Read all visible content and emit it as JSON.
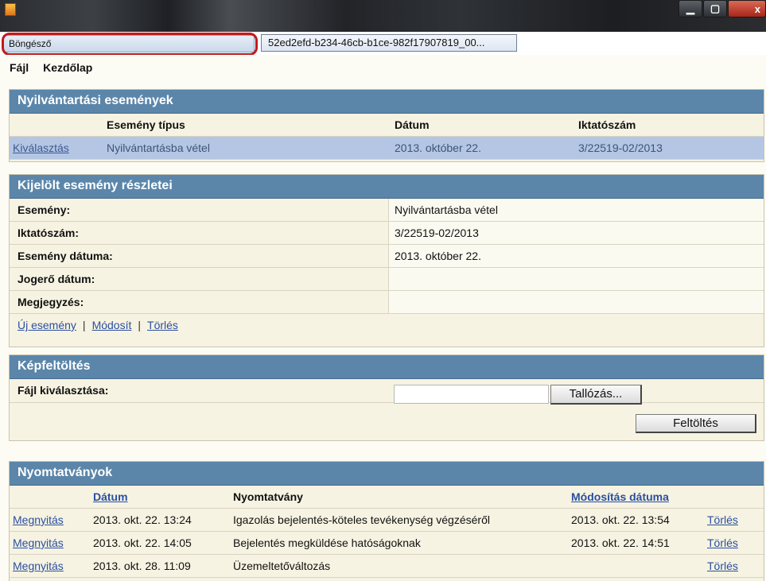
{
  "window": {
    "minimize_glyph": "▁",
    "maximize_glyph": "▢",
    "close_glyph": "x"
  },
  "tabs": {
    "main_label": "Böngésző",
    "second_label": "52ed2efd-b234-46cb-b1ce-982f17907819_00..."
  },
  "menu": {
    "items": [
      "Fájl",
      "Kezdőlap"
    ]
  },
  "events": {
    "title": "Nyilvántartási események",
    "headers": {
      "type": "Esemény típus",
      "date": "Dátum",
      "number": "Iktatószám"
    },
    "rows": [
      {
        "action": "Kiválasztás",
        "type": "Nyilvántartásba vétel",
        "date": "2013. október 22.",
        "number": "3/22519-02/2013"
      }
    ]
  },
  "details": {
    "title": "Kijelölt esemény részletei",
    "fields": [
      {
        "label": "Esemény:",
        "value": "Nyilvántartásba vétel"
      },
      {
        "label": "Iktatószám:",
        "value": "3/22519-02/2013"
      },
      {
        "label": "Esemény dátuma:",
        "value": "2013. október 22."
      },
      {
        "label": "Jogerő dátum:",
        "value": ""
      },
      {
        "label": "Megjegyzés:",
        "value": ""
      }
    ],
    "actions": {
      "new": "Új esemény",
      "sep": "|",
      "modify": "Módosít",
      "delete": "Törlés"
    }
  },
  "upload": {
    "title": "Képfeltöltés",
    "file_label": "Fájl kiválasztása:",
    "browse_button": "Tallózás...",
    "upload_button": "Feltöltés"
  },
  "forms": {
    "title": "Nyomtatványok",
    "headers": {
      "date": "Dátum",
      "form": "Nyomtatvány",
      "modified": "Módosítás dátuma"
    },
    "rows": [
      {
        "open": "Megnyitás",
        "date": "2013. okt. 22. 13:24",
        "form": "Igazolás bejelentés-köteles tevékenység végzéséről",
        "modified": "2013. okt. 22. 13:54",
        "delete": "Törlés"
      },
      {
        "open": "Megnyitás",
        "date": "2013. okt. 22. 14:05",
        "form": "Bejelentés megküldése hatóságoknak",
        "modified": "2013. okt. 22. 14:51",
        "delete": "Törlés"
      },
      {
        "open": "Megnyitás",
        "date": "2013. okt. 28. 11:09",
        "form": "Üzemeltetőváltozás",
        "modified": "",
        "delete": "Törlés"
      }
    ]
  }
}
